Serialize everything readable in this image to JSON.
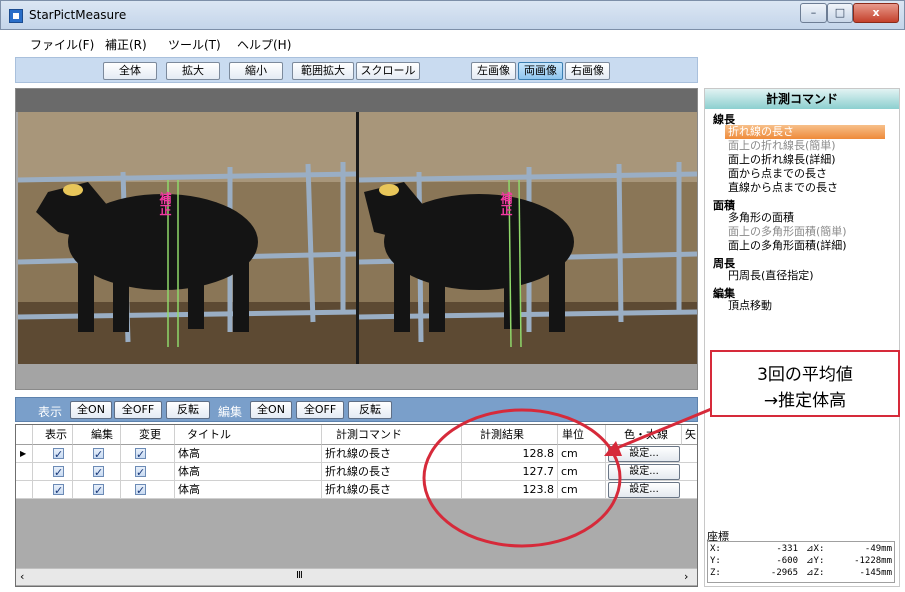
{
  "window": {
    "title": "StarPictMeasure",
    "minimize": "–",
    "maximize": "□",
    "close": "x"
  },
  "menu": [
    "ファイル(F)",
    "補正(R)",
    "ツール(T)",
    "ヘルプ(H)"
  ],
  "toolbar": {
    "left": [
      "全体",
      "拡大",
      "縮小",
      "範囲拡大",
      "スクロール"
    ],
    "right": [
      "左画像",
      "両画像",
      "右画像"
    ],
    "active": "両画像"
  },
  "editbar": {
    "label_display": "表示",
    "label_edit": "編集",
    "buttons": [
      "全ON",
      "全OFF",
      "反転"
    ]
  },
  "table": {
    "headers": [
      "表示",
      "編集",
      "変更",
      "タイトル",
      "計測コマンド",
      "計測結果",
      "単位",
      "色・太線",
      "矢"
    ],
    "rows": [
      {
        "title": "体高",
        "command": "折れ線の長さ",
        "result": "128.8",
        "unit": "cm",
        "button": "設定..."
      },
      {
        "title": "体高",
        "command": "折れ線の長さ",
        "result": "127.7",
        "unit": "cm",
        "button": "設定..."
      },
      {
        "title": "体高",
        "command": "折れ線の長さ",
        "result": "123.8",
        "unit": "cm",
        "button": "設定..."
      }
    ],
    "scroll_left": "‹",
    "scroll_right": "›",
    "scroll_thumb": "Ⅲ"
  },
  "commands": {
    "header": "計測コマンド",
    "categories": [
      {
        "name": "線長",
        "items": [
          {
            "label": "折れ線の長さ",
            "state": "selected"
          },
          {
            "label": "面上の折れ線長(簡単)",
            "state": "disabled"
          },
          {
            "label": "面上の折れ線長(詳細)",
            "state": "normal"
          },
          {
            "label": "面から点までの長さ",
            "state": "normal"
          },
          {
            "label": "直線から点までの長さ",
            "state": "normal"
          }
        ]
      },
      {
        "name": "面積",
        "items": [
          {
            "label": "多角形の面積",
            "state": "normal"
          },
          {
            "label": "面上の多角形面積(簡単)",
            "state": "disabled"
          },
          {
            "label": "面上の多角形面積(詳細)",
            "state": "normal"
          }
        ]
      },
      {
        "name": "周長",
        "items": [
          {
            "label": "円周長(直径指定)",
            "state": "normal"
          }
        ]
      },
      {
        "name": "編集",
        "items": [
          {
            "label": "頂点移動",
            "state": "normal"
          }
        ]
      }
    ]
  },
  "coordinates": {
    "title": "座標",
    "rows": [
      {
        "axis": "X:",
        "value": "-331",
        "dlabel": "⊿X:",
        "delta": "-49mm"
      },
      {
        "axis": "Y:",
        "value": "-600",
        "dlabel": "⊿Y:",
        "delta": "-1228mm"
      },
      {
        "axis": "Z:",
        "value": "-2965",
        "dlabel": "⊿Z:",
        "delta": "-145mm"
      }
    ]
  },
  "image_labels": {
    "left": "補正",
    "right": "補正"
  },
  "callout": {
    "line1": "3回の平均値",
    "line2": "→推定体高"
  },
  "colors": {
    "accent_red": "#d62a3a",
    "selected_orange": "#ee8a3a",
    "toolbar_blue": "#c9dbf0",
    "editbar_blue": "#7a9fca"
  }
}
